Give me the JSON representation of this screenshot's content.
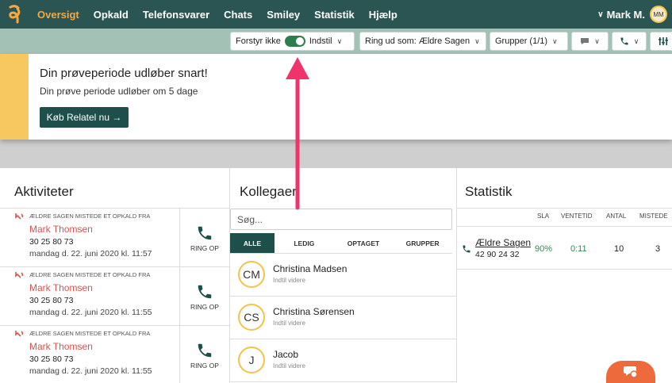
{
  "nav": {
    "items": [
      "Oversigt",
      "Opkald",
      "Telefonsvarer",
      "Chats",
      "Smiley",
      "Statistik",
      "Hjælp"
    ],
    "user_name": "Mark M.",
    "user_initials": "MM"
  },
  "toolbar": {
    "dnd_label": "Forstyr ikke",
    "settings_label": "Indstil",
    "call_as": "Ring ud som: Ældre Sagen",
    "groups": "Grupper (1/1)"
  },
  "banner": {
    "title": "Din prøveperiode udløber snart!",
    "subtitle": "Din prøve periode udløber om 5 dage",
    "button": "Køb Relatel nu →"
  },
  "activities": {
    "title": "Aktiviteter",
    "call_label": "RING OP",
    "items": [
      {
        "header": "ÆLDRE SAGEN MISTEDE ET OPKALD FRA",
        "name": "Mark Thomsen",
        "number": "30 25 80 73",
        "date": "mandag d. 22. juni 2020 kl. 11:57"
      },
      {
        "header": "ÆLDRE SAGEN MISTEDE ET OPKALD FRA",
        "name": "Mark Thomsen",
        "number": "30 25 80 73",
        "date": "mandag d. 22. juni 2020 kl. 11:55"
      },
      {
        "header": "ÆLDRE SAGEN MISTEDE ET OPKALD FRA",
        "name": "Mark Thomsen",
        "number": "30 25 80 73",
        "date": "mandag d. 22. juni 2020 kl. 11:55"
      }
    ]
  },
  "colleagues": {
    "title": "Kollegaer",
    "search_placeholder": "Søg...",
    "tabs": [
      "ALLE",
      "LEDIG",
      "OPTAGET",
      "GRUPPER"
    ],
    "items": [
      {
        "initials": "CM",
        "name": "Christina Madsen",
        "status": "Indtil videre"
      },
      {
        "initials": "CS",
        "name": "Christina Sørensen",
        "status": "Indtil videre"
      },
      {
        "initials": "J",
        "name": "Jacob",
        "status": "Indtil videre"
      }
    ]
  },
  "statistics": {
    "title": "Statistik",
    "headers": [
      "SLA",
      "VENTETID",
      "ANTAL",
      "MISTEDE"
    ],
    "queue_name": "Ældre Sagen",
    "queue_number": "42 90 24 32",
    "sla": "90%",
    "wait": "0:11",
    "count": "10",
    "missed": "3"
  },
  "colors": {
    "nav_bg": "#2a5552",
    "active_nav": "#f5a843",
    "toolbar_bg": "#a3c2b5",
    "accent_dark": "#1f4f4b",
    "banner_stripe": "#f6c85f",
    "missed_red": "#d9534f",
    "fab_orange": "#ec6a3b",
    "arrow_pink": "#f0336b"
  }
}
